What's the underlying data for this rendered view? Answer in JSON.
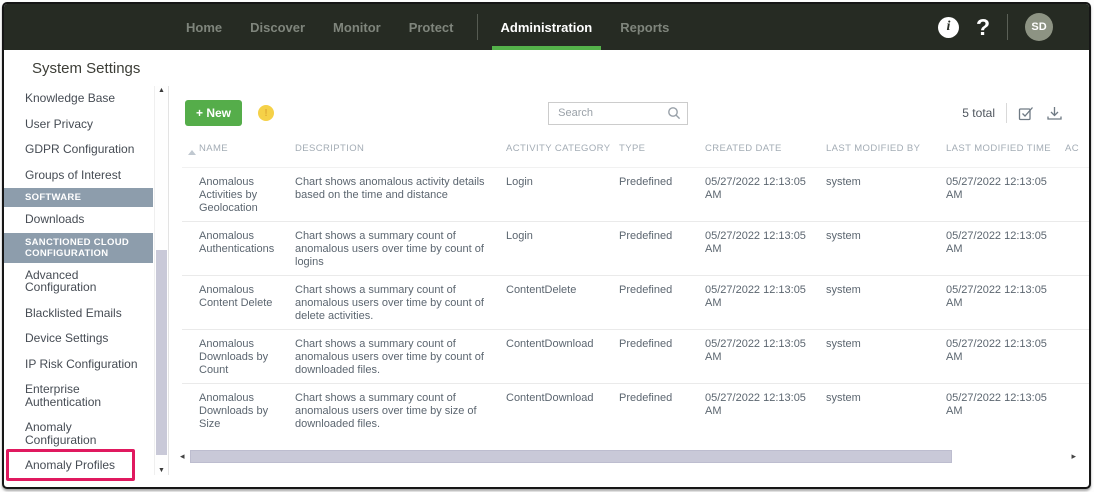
{
  "nav": {
    "items": [
      {
        "label": "Home"
      },
      {
        "label": "Discover"
      },
      {
        "label": "Monitor"
      },
      {
        "label": "Protect"
      },
      {
        "label": "Administration",
        "active": true
      },
      {
        "label": "Reports"
      }
    ],
    "info_label": "i",
    "help_label": "?",
    "avatar_initials": "SD"
  },
  "sidebar": {
    "title": "System Settings",
    "items": [
      {
        "label": "Knowledge Base"
      },
      {
        "label": "User Privacy"
      },
      {
        "label": "GDPR Configuration"
      },
      {
        "label": "Groups of Interest"
      },
      {
        "label": "SOFTWARE",
        "type": "header"
      },
      {
        "label": "Downloads"
      },
      {
        "label": "SANCTIONED CLOUD\nCONFIGURATION",
        "type": "header"
      },
      {
        "label": "Advanced\nConfiguration"
      },
      {
        "label": "Blacklisted Emails"
      },
      {
        "label": "Device Settings"
      },
      {
        "label": "IP Risk Configuration"
      },
      {
        "label": "Enterprise\nAuthentication"
      },
      {
        "label": "Anomaly\nConfiguration"
      },
      {
        "label": "Anomaly Profiles",
        "annotated": true
      }
    ]
  },
  "toolbar": {
    "new_label": "+ New",
    "search_placeholder": "Search",
    "total_label": "5 total"
  },
  "table": {
    "columns": [
      "NAME",
      "DESCRIPTION",
      "ACTIVITY CATEGORY",
      "TYPE",
      "CREATED DATE",
      "LAST MODIFIED BY",
      "LAST MODIFIED TIME",
      "AC"
    ],
    "rows": [
      {
        "name": "Anomalous\nActivities by\nGeolocation",
        "description": "Chart shows anomalous activity details\nbased on the time and distance",
        "activity_category": "Login",
        "type": "Predefined",
        "created_date": "05/27/2022 12:13:05 AM",
        "last_modified_by": "system",
        "last_modified_time": "05/27/2022 12:13:05 AM"
      },
      {
        "name": "Anomalous\nAuthentications",
        "description": "Chart shows a summary count of\nanomalous users over time by count of\nlogins",
        "activity_category": "Login",
        "type": "Predefined",
        "created_date": "05/27/2022 12:13:05 AM",
        "last_modified_by": "system",
        "last_modified_time": "05/27/2022 12:13:05 AM"
      },
      {
        "name": "Anomalous\nContent Delete",
        "description": "Chart shows a summary count of\nanomalous users over time by count of\ndelete activities.",
        "activity_category": "ContentDelete",
        "type": "Predefined",
        "created_date": "05/27/2022 12:13:05 AM",
        "last_modified_by": "system",
        "last_modified_time": "05/27/2022 12:13:05 AM"
      },
      {
        "name": "Anomalous\nDownloads by\nCount",
        "description": "Chart shows a summary count of\nanomalous users over time by count of\ndownloaded files.",
        "activity_category": "ContentDownload",
        "type": "Predefined",
        "created_date": "05/27/2022 12:13:05 AM",
        "last_modified_by": "system",
        "last_modified_time": "05/27/2022 12:13:05 AM"
      },
      {
        "name": "Anomalous\nDownloads by\nSize",
        "description": "Chart shows a summary count of\nanomalous users over time by size of\ndownloaded files.",
        "activity_category": "ContentDownload",
        "type": "Predefined",
        "created_date": "05/27/2022 12:13:05 AM",
        "last_modified_by": "system",
        "last_modified_time": "05/27/2022 12:13:05 AM"
      }
    ]
  },
  "colors": {
    "nav_bg": "#262b23",
    "accent_green": "#55ad4a",
    "section_header_bg": "#8d9dac",
    "annotation_red": "#e0195f",
    "scrollbar_thumb": "#c9c9d8",
    "alert_yellow": "#f5d148"
  }
}
